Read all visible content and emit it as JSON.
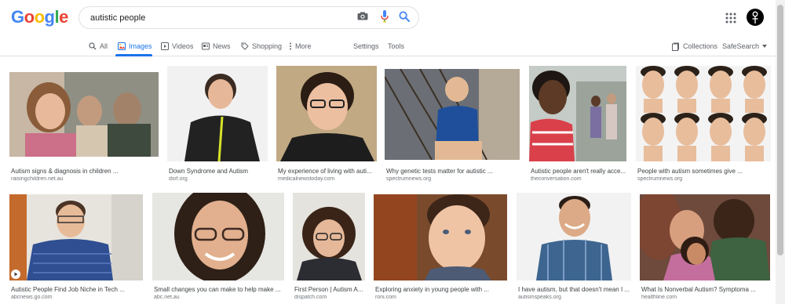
{
  "logo": {
    "letters": [
      "G",
      "o",
      "o",
      "g",
      "l",
      "e"
    ],
    "colors": [
      "#4285f4",
      "#ea4335",
      "#fbbc05",
      "#4285f4",
      "#34a853",
      "#ea4335"
    ]
  },
  "search": {
    "query": "autistic people"
  },
  "tabs": {
    "all": "All",
    "images": "Images",
    "videos": "Videos",
    "news": "News",
    "shopping": "Shopping",
    "more": "More",
    "settings": "Settings",
    "tools": "Tools",
    "collections": "Collections",
    "safesearch": "SafeSearch"
  },
  "results": [
    {
      "title": "Autism signs & diagnosis in children ...",
      "source": "raisingchildren.net.au"
    },
    {
      "title": "Down Syndrome and Autism",
      "source": "dsrf.org"
    },
    {
      "title": "My experience of living with auti...",
      "source": "medicalnewstoday.com"
    },
    {
      "title": "Why genetic tests matter for autistic ...",
      "source": "spectrumnews.org"
    },
    {
      "title": "Autistic people aren't really acce...",
      "source": "theconversation.com"
    },
    {
      "title": "People with autism sometimes give ...",
      "source": "spectrumnews.org"
    },
    {
      "title": "Autistic People Find Job Niche in Tech ...",
      "source": "abcnews.go.com"
    },
    {
      "title": "Small changes you can make to help make ...",
      "source": "abc.net.au"
    },
    {
      "title": "First Person | Autism A...",
      "source": "dispatch.com"
    },
    {
      "title": "Exploring anxiety in young people with ...",
      "source": "roni.com"
    },
    {
      "title": "I have autism, but that doesn't mean I ...",
      "source": "autismspeaks.org"
    },
    {
      "title": "What Is Nonverbal Autism? Symptoma ...",
      "source": "healthline.com"
    }
  ]
}
